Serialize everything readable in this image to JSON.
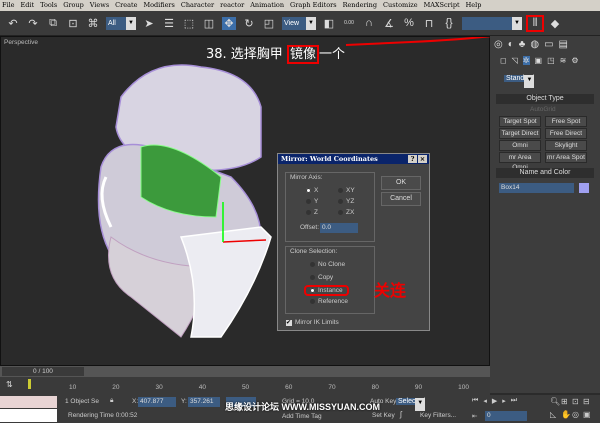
{
  "menu": [
    "File",
    "Edit",
    "Tools",
    "Group",
    "Views",
    "Create",
    "Modifiers",
    "Character",
    "reactor",
    "Animation",
    "Graph Editors",
    "Rendering",
    "Customize",
    "MAXScript",
    "Help"
  ],
  "toolbar": {
    "selection_filter": "All",
    "ref_coord": "View",
    "snap_value": "0.00",
    "icons": [
      "undo-icon",
      "redo-icon",
      "select-link-icon",
      "unlink-icon",
      "bind-space-warp-icon",
      "select-object-icon",
      "select-by-name-icon",
      "rect-region-icon",
      "window-crossing-icon",
      "move-icon",
      "rotate-icon",
      "scale-icon",
      "pivot-icon",
      "snap-toggle-icon",
      "angle-snap-icon",
      "percent-snap-icon",
      "spinner-snap-icon",
      "named-selection-icon",
      "mirror-icon",
      "align-icon"
    ]
  },
  "viewport": {
    "label": "Perspective",
    "annotation_prefix": "38. 选择胸甲 ",
    "annotation_highlight": "镜像",
    "annotation_suffix": "一个"
  },
  "dialog": {
    "title": "Mirror: World Coordinates",
    "help": "?",
    "close": "×",
    "mirror_axis_label": "Mirror Axis:",
    "axes": [
      "X",
      "Y",
      "Z"
    ],
    "planes": [
      "XY",
      "YZ",
      "ZX"
    ],
    "selected_axis": "X",
    "offset_label": "Offset:",
    "offset_value": "0.0",
    "ok": "OK",
    "cancel": "Cancel",
    "clone_label": "Clone Selection:",
    "clone_options": [
      "No Clone",
      "Copy",
      "Instance",
      "Reference"
    ],
    "selected_clone": "Instance",
    "annotation": "关连",
    "mirror_ik": "Mirror IK Limits",
    "mirror_ik_checked": true
  },
  "panel": {
    "category": "Standard",
    "object_type": "Object Type",
    "autogrid": "AutoGrid",
    "buttons": [
      "Target Spot",
      "Free Spot",
      "Target Direct",
      "Free Direct",
      "Omni",
      "Skylight",
      "mr Area Omni",
      "mr Area Spot"
    ],
    "name_color": "Name and Color",
    "object_name": "Box14",
    "object_color": "#a0a0f0"
  },
  "timeline": {
    "frame": "0 / 100",
    "ticks": [
      "10",
      "20",
      "30",
      "40",
      "50",
      "60",
      "70",
      "80",
      "90",
      "100"
    ]
  },
  "status": {
    "selection": "1 Object Se",
    "x_label": "X:",
    "x": "407.877",
    "y_label": "Y:",
    "y": "357.261",
    "grid": "Grid = 10.0",
    "rendering_time": "Rendering Time  0:00:52",
    "add_time_tag": "Add Time Tag",
    "auto_key": "Auto Key",
    "set_key": "Set Key",
    "key_mode": "Selected",
    "key_filters": "Key Filters...",
    "current_frame": "0",
    "watermark": "思缘设计论坛 WWW.MISSYUAN.COM"
  }
}
